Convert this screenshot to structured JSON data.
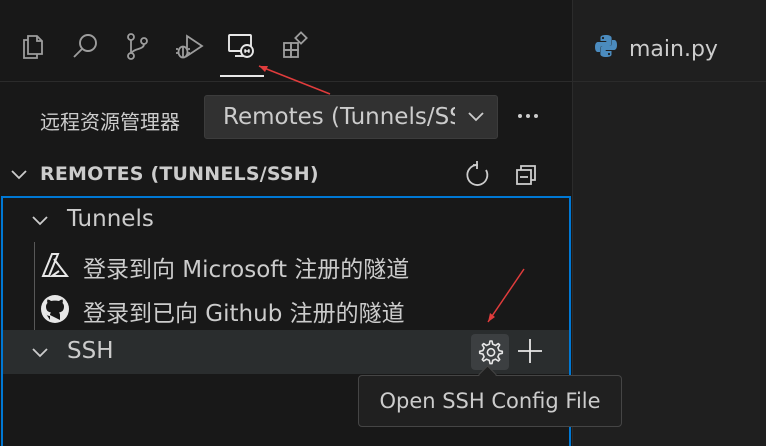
{
  "activity_bar": {
    "icons": [
      "explorer-icon",
      "search-icon",
      "source-control-icon",
      "run-debug-icon",
      "remote-explorer-icon",
      "extensions-icon"
    ],
    "active": "remote-explorer-icon"
  },
  "editor": {
    "tab": {
      "label": "main.py",
      "icon": "python-icon"
    }
  },
  "explorer": {
    "label": "远程资源管理器",
    "select_value": "Remotes (Tunnels/SSH)",
    "more_icon": "ellipsis-icon"
  },
  "section": {
    "title": "REMOTES (TUNNELS/SSH)",
    "refresh_icon": "refresh-icon",
    "collapse_icon": "collapse-all-icon"
  },
  "tree": {
    "tunnels_label": "Tunnels",
    "microsoft_label": "登录到向 Microsoft 注册的隧道",
    "github_label": "登录到已向 Github 注册的隧道",
    "ssh_label": "SSH",
    "ssh_actions": [
      "gear-icon",
      "plus-icon"
    ]
  },
  "tooltip": {
    "text": "Open SSH Config File"
  },
  "colors": {
    "sidebar_bg": "#181818",
    "editor_bg": "#1f1f1f",
    "focus_border": "#0078d4",
    "annotation_arrow": "#e03c3c",
    "python_blue": "#4b8bbe"
  }
}
